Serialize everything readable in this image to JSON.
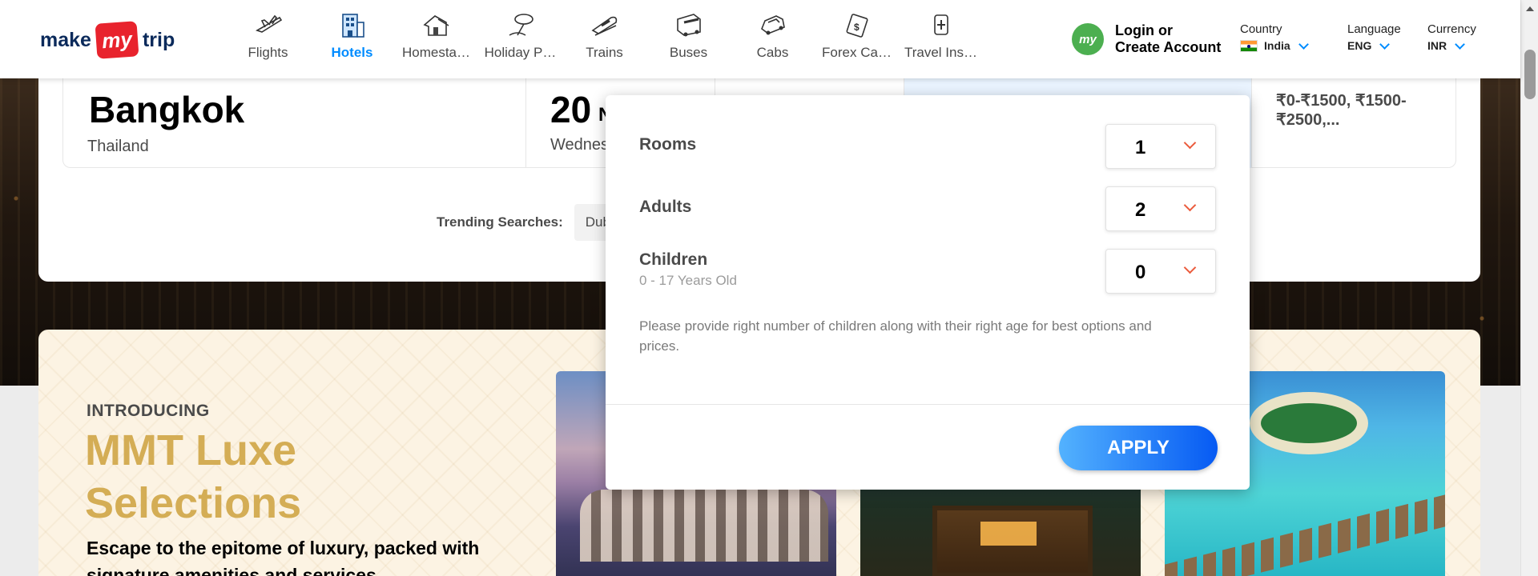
{
  "logo": {
    "pre": "make",
    "my": "my",
    "post": "trip"
  },
  "nav": [
    {
      "label": "Flights",
      "icon": "flight-icon",
      "active": false
    },
    {
      "label": "Hotels",
      "icon": "hotel-icon",
      "active": true
    },
    {
      "label": "Homesta…",
      "icon": "homestay-icon",
      "active": false
    },
    {
      "label": "Holiday P…",
      "icon": "holiday-icon",
      "active": false
    },
    {
      "label": "Trains",
      "icon": "train-icon",
      "active": false
    },
    {
      "label": "Buses",
      "icon": "bus-icon",
      "active": false
    },
    {
      "label": "Cabs",
      "icon": "cab-icon",
      "active": false
    },
    {
      "label": "Forex Ca…",
      "icon": "forex-card-icon",
      "active": false
    },
    {
      "label": "Travel Ins…",
      "icon": "insurance-icon",
      "active": false
    }
  ],
  "account": {
    "badge": "my",
    "line1": "Login or",
    "line2": "Create Account"
  },
  "prefs": {
    "country": {
      "title": "Country",
      "value": "India"
    },
    "language": {
      "title": "Language",
      "value": "ENG"
    },
    "currency": {
      "title": "Currency",
      "value": "INR"
    }
  },
  "search": {
    "city": "Bangkok",
    "country": "Thailand",
    "checkin_day": "20",
    "checkin_month": "N",
    "checkin_weekday": "Wednes",
    "price_range": "₹0-₹1500, ₹1500-₹2500,...",
    "trending_label": "Trending Searches:",
    "trending_chip": "Dub"
  },
  "guests": {
    "rooms": {
      "label": "Rooms",
      "value": "1"
    },
    "adults": {
      "label": "Adults",
      "value": "2"
    },
    "children": {
      "label": "Children",
      "sub": "0 - 17 Years Old",
      "value": "0"
    },
    "note": "Please provide right number of children along with their right age for best options and prices.",
    "apply": "APPLY"
  },
  "luxe": {
    "intro": "INTRODUCING",
    "title": "MMT Luxe Selections",
    "subtitle": "Escape to the epitome of luxury, packed with signature amenities and services"
  },
  "colors": {
    "brand_blue": "#008cff",
    "brand_red": "#e8232d",
    "luxe_gold": "#d4ad55",
    "chevron_orange": "#eb5b3c"
  }
}
